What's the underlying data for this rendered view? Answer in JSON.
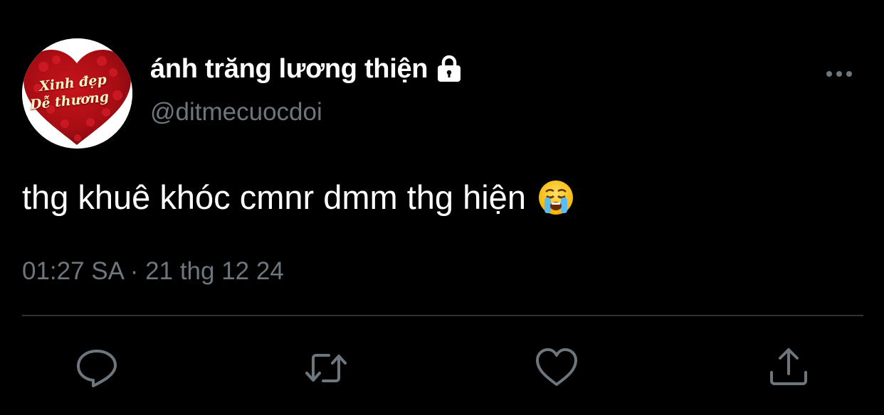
{
  "author": {
    "avatar_text_line1": "Xinh đẹp",
    "avatar_text_line2": "Dễ thương",
    "display_name": "ánh trăng lương thiện",
    "handle": "@ditmecuocdoi",
    "locked_icon": "lock-icon"
  },
  "tweet": {
    "text": "thg khuê khóc cmnr dmm thg hiện",
    "emoji": "loudly-crying-face",
    "timestamp": "01:27 SA · 21 thg 12 24"
  },
  "actions": {
    "reply_icon": "reply-icon",
    "retweet_icon": "retweet-icon",
    "like_icon": "heart-icon",
    "share_icon": "share-icon"
  },
  "colors": {
    "background": "#000000",
    "primary_text": "#ffffff",
    "secondary_text": "#6e767d",
    "divider": "#2f3336",
    "icon": "#6e767d"
  }
}
